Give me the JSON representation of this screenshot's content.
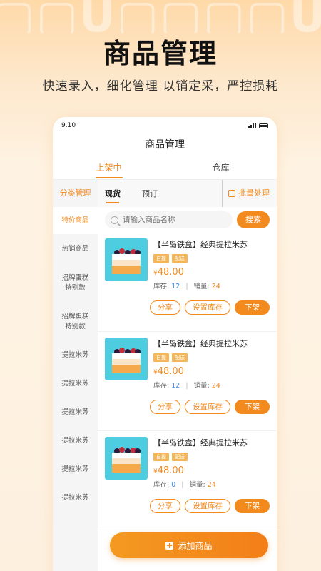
{
  "promo": {
    "title": "商品管理",
    "subtitle": "快速录入，细化管理 以销定采，严控损耗"
  },
  "status": {
    "time": "9.10"
  },
  "header": {
    "title": "商品管理"
  },
  "top_tabs": [
    {
      "label": "上架中",
      "active": true
    },
    {
      "label": "仓库",
      "active": false
    }
  ],
  "sidebar": {
    "head": "分类管理",
    "items": [
      {
        "label": "特价商品",
        "active": true
      },
      {
        "label": "热销商品",
        "active": false
      },
      {
        "label": "招牌蛋糕\n特别款",
        "active": false
      },
      {
        "label": "招牌蛋糕\n特别款",
        "active": false
      },
      {
        "label": "提拉米苏",
        "active": false
      },
      {
        "label": "提拉米苏",
        "active": false
      },
      {
        "label": "提拉米苏",
        "active": false
      },
      {
        "label": "提拉米苏",
        "active": false
      },
      {
        "label": "提拉米苏",
        "active": false
      },
      {
        "label": "提拉米苏",
        "active": false
      }
    ]
  },
  "sub_tabs": [
    {
      "label": "现货",
      "active": true
    },
    {
      "label": "预订",
      "active": false
    }
  ],
  "batch_label": "批量处理",
  "search": {
    "placeholder": "请输入商品名称",
    "button": "搜索"
  },
  "products": [
    {
      "name": "【半岛铁盒】经典提拉米苏",
      "tags": [
        "自提",
        "配送"
      ],
      "currency": "¥",
      "price": "48.00",
      "stock_label": "库存:",
      "stock": "12",
      "sales_label": "销量:",
      "sales": "24",
      "actions": [
        "分享",
        "设置库存"
      ],
      "primary": "下架"
    },
    {
      "name": "【半岛铁盒】经典提拉米苏",
      "tags": [
        "自提",
        "配送"
      ],
      "currency": "¥",
      "price": "48.00",
      "stock_label": "库存:",
      "stock": "12",
      "sales_label": "销量:",
      "sales": "24",
      "actions": [
        "分享",
        "设置库存"
      ],
      "primary": "下架"
    },
    {
      "name": "【半岛铁盒】经典提拉米苏",
      "tags": [
        "自提",
        "配送"
      ],
      "currency": "¥",
      "price": "48.00",
      "stock_label": "库存:",
      "stock": "0",
      "sales_label": "销量:",
      "sales": "24",
      "actions": [
        "分享",
        "设置库存"
      ],
      "primary": "下架"
    }
  ],
  "add_button": "添加商品",
  "colors": {
    "accent": "#f38a1d",
    "stock_blue": "#3a8ee6",
    "tag_bg": "#f5b659",
    "image_bg": "#4fcde0"
  },
  "icons": {
    "search": "search-icon",
    "batch": "batch-icon",
    "add": "plus-icon"
  }
}
